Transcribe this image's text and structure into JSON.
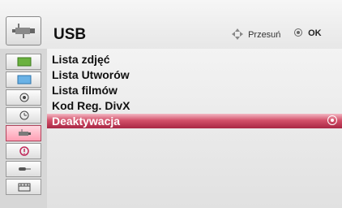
{
  "header": {
    "title": "USB",
    "move_hint": "Przesuń",
    "ok_hint": "OK",
    "icon": "usb-icon"
  },
  "sidebar": {
    "items": [
      {
        "icon": "picture-icon"
      },
      {
        "icon": "screen-icon"
      },
      {
        "icon": "target-icon"
      },
      {
        "icon": "clock-icon"
      },
      {
        "icon": "usb-icon",
        "active": true
      },
      {
        "icon": "info-icon"
      },
      {
        "icon": "connector-icon"
      },
      {
        "icon": "film-icon"
      }
    ]
  },
  "menu": {
    "items": [
      {
        "label": "Lista zdjęć"
      },
      {
        "label": "Lista Utworów"
      },
      {
        "label": "Lista filmów"
      },
      {
        "label": "Kod Reg. DivX"
      },
      {
        "label": "Deaktywacja",
        "selected": true
      }
    ]
  },
  "colors": {
    "accent": "#c73a57",
    "panel": "#e6e6e6"
  }
}
